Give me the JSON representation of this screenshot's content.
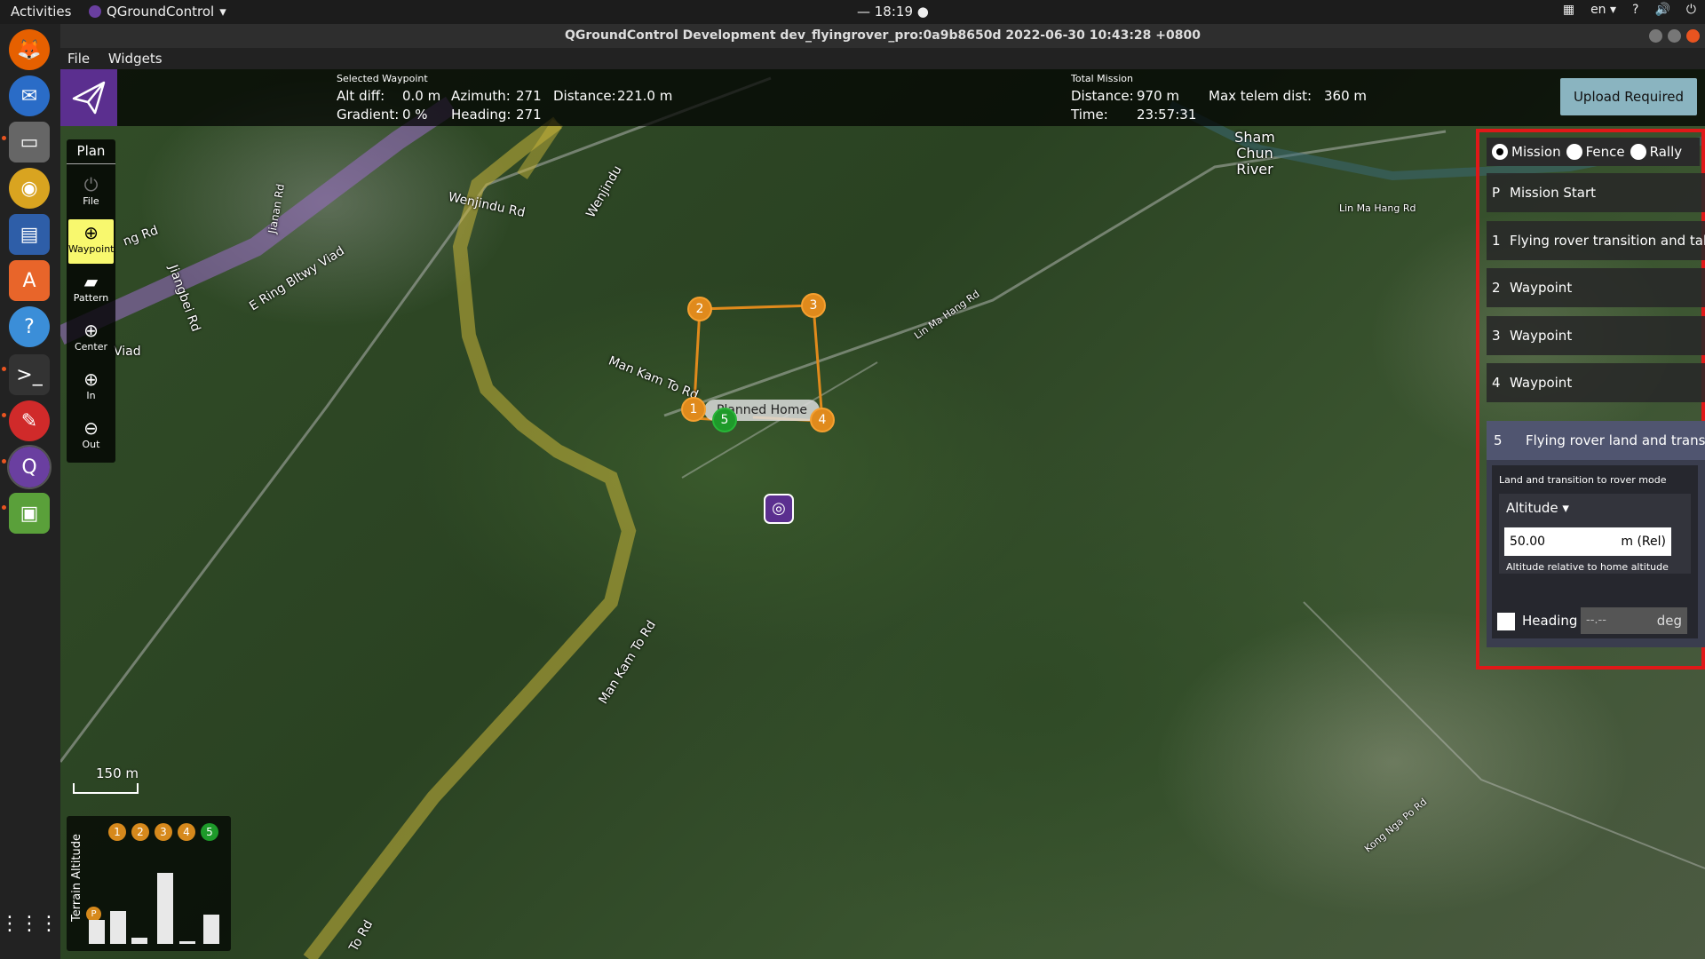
{
  "os": {
    "activities": "Activities",
    "app_menu": "QGroundControl",
    "clock": "— 18:19 ●",
    "lang": "en",
    "help": "?",
    "volume": "🔊",
    "power": "⏻"
  },
  "window": {
    "title": "QGroundControl Development dev_flyingrover_pro:0a9b8650d 2022-06-30 10:43:28 +0800"
  },
  "menu": {
    "file": "File",
    "widgets": "Widgets"
  },
  "stats": {
    "selected_header": "Selected Waypoint",
    "alt_diff_label": "Alt diff:",
    "alt_diff_value": "0.0 m",
    "azimuth_label": "Azimuth:",
    "azimuth_value": "271",
    "distance_label": "Distance:",
    "distance_value": "221.0 m",
    "gradient_label": "Gradient:",
    "gradient_value": "0 %",
    "heading_label": "Heading:",
    "heading_value": "271",
    "total_header": "Total Mission",
    "total_distance_label": "Distance:",
    "total_distance_value": "970 m",
    "max_telem_label": "Max telem dist:",
    "max_telem_value": "360 m",
    "time_label": "Time:",
    "time_value": "23:57:31",
    "upload_button": "Upload Required"
  },
  "toolbar": {
    "title": "Plan",
    "items": [
      {
        "label": "File",
        "icon": "⏻"
      },
      {
        "label": "Waypoint",
        "icon": "⊕"
      },
      {
        "label": "Pattern",
        "icon": "▰"
      },
      {
        "label": "Center",
        "icon": "⊕"
      },
      {
        "label": "In",
        "icon": "⊕"
      },
      {
        "label": "Out",
        "icon": "⊖"
      }
    ]
  },
  "panel": {
    "radios": {
      "mission": "Mission",
      "fence": "Fence",
      "rally": "Rally",
      "selected": "Mission"
    },
    "items": [
      {
        "num": "P",
        "label": "Mission Start"
      },
      {
        "num": "1",
        "label": "Flying rover transition and take"
      },
      {
        "num": "2",
        "label": "Waypoint"
      },
      {
        "num": "3",
        "label": "Waypoint"
      },
      {
        "num": "4",
        "label": "Waypoint"
      },
      {
        "num": "5",
        "label": "Flying rover land and transi"
      }
    ],
    "editor": {
      "description": "Land and transition to rover mode",
      "altitude_dropdown": "Altitude",
      "altitude_value": "50.00",
      "altitude_unit": "m (Rel)",
      "altitude_help": "Altitude relative to home altitude",
      "heading_label": "Heading",
      "heading_value": "--.--",
      "heading_unit": "deg"
    }
  },
  "map": {
    "labels": {
      "e_ring": "E Ring Bltwy Viad",
      "viad": "Viad",
      "jiangbei": "Jiangbei Rd",
      "jianan": "Jianan Rd",
      "yu_rd": "ng Rd",
      "wenjindu": "Wenjindu Rd",
      "wenjindu2": "Wenjindu",
      "man_kam_to": "Man Kam To Rd",
      "man_kam_to2": "Man Kam To Rd",
      "to_rd": "To Rd",
      "lin_ma_hang": "Lin Ma Hang Rd",
      "lin_ma_hang2": "Lin Ma Hang Rd",
      "sham_chun": "Sham Chun River",
      "kong_nga_po": "Kong Nga Po Rd",
      "planned_home": "Planned Home"
    },
    "waypoints": [
      "1",
      "2",
      "3",
      "4",
      "5"
    ],
    "scale_label": "150 m"
  },
  "terrain": {
    "ylabel": "Terrain Altitude",
    "home_marker": "P",
    "chips": [
      "1",
      "2",
      "3",
      "4",
      "5"
    ],
    "bar_values": [
      20,
      28,
      5,
      60,
      2,
      25
    ]
  },
  "colors": {
    "accent_purple": "#5b2f8f",
    "waypoint_orange": "#e08a1c",
    "waypoint_green": "#1e9a2a",
    "upload_button": "#8ab4c0",
    "highlight_red": "#e01818",
    "active_tool": "#f8f86e"
  }
}
